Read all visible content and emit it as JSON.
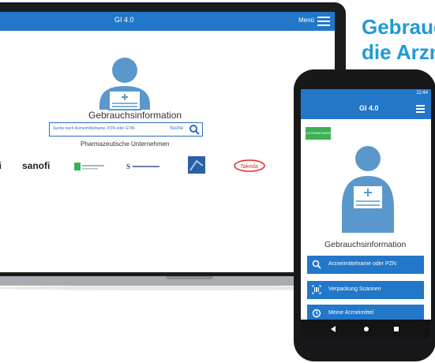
{
  "headline": {
    "line1": "Gebrauchsinformation",
    "line2": "die Arzneimittel"
  },
  "laptop": {
    "app_title": "GI 4.0",
    "menu_label": "Menü",
    "gi_label": "Gebrauchsinformation",
    "search": {
      "placeholder": "Suche nach Arzneimittelname, PZN oder GTIN",
      "button_label": "Suche"
    },
    "pharma_label": "Pharmazeutische Unternehmen",
    "logos": [
      "sanofi",
      "sanofi",
      "Winthrop",
      "STADAPHARM",
      "Partner",
      "Takeda"
    ]
  },
  "phone": {
    "status_time": "11:44",
    "app_title": "GI 4.0",
    "badge_text": "UNTERNEHMEN",
    "gi_label": "Gebrauchsinformation",
    "buttons": [
      {
        "label": "Arzneimittelname oder PZN",
        "icon": "search-icon"
      },
      {
        "label": "Verpackung Scannen",
        "icon": "barcode-icon"
      },
      {
        "label": "Meine Arzneimittel",
        "icon": "clock-icon"
      }
    ]
  },
  "colors": {
    "brand_blue": "#2277c8",
    "headline_blue": "#1f9ad6",
    "figure_blue": "#5a98cc",
    "badge_green": "#3db054"
  }
}
